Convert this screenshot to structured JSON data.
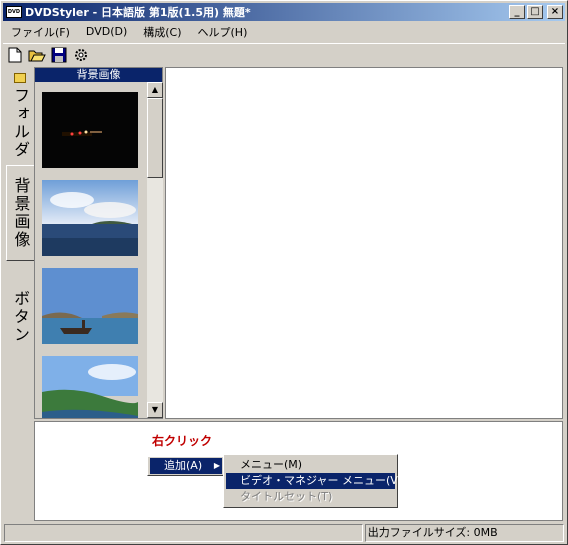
{
  "window": {
    "title": "DVDStyler - 日本語版 第1版(1.5用)  無題*",
    "app_icon_text": "DVD"
  },
  "title_buttons": {
    "minimize": "_",
    "maximize": "□",
    "close": "×"
  },
  "menubar": {
    "items": [
      "ファイル(F)",
      "DVD(D)",
      "構成(C)",
      "ヘルプ(H)"
    ]
  },
  "toolbar": {
    "icons": [
      "new-file-icon",
      "open-folder-icon",
      "save-icon",
      "settings-icon"
    ]
  },
  "side_tabs": [
    {
      "label": "フォルダ",
      "icon": "folder-icon",
      "active": false
    },
    {
      "label": "背景画像",
      "active": true
    },
    {
      "label": "ボタン",
      "active": false
    }
  ],
  "panel": {
    "header": "背景画像",
    "thumbnails": [
      "night-road",
      "sea-island",
      "shipwreck-bay",
      "coast-hill"
    ]
  },
  "annotation": {
    "text": "右クリック"
  },
  "context_menu": {
    "items": [
      {
        "label": "追加(A)",
        "has_submenu": true
      }
    ]
  },
  "submenu": {
    "items": [
      {
        "label": "メニュー(M)",
        "state": "normal"
      },
      {
        "label": "ビデオ・マネジャー メニュー(V)",
        "state": "highlighted"
      },
      {
        "label": "タイトルセット(T)",
        "state": "disabled"
      }
    ]
  },
  "statusbar": {
    "left": "",
    "right": "出力ファイルサイズ: 0MB"
  },
  "colors": {
    "titlebar": "#0a246a",
    "highlight": "#0a246a",
    "annotation": "#c00000",
    "face": "#d4d0c8"
  }
}
